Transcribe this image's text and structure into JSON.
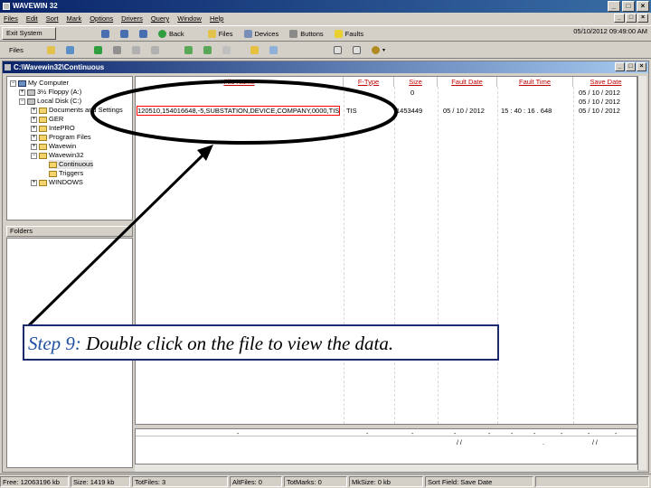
{
  "window": {
    "title": "WAVEWIN 32",
    "minimize": "_",
    "maximize": "□",
    "close": "×"
  },
  "menu": [
    "Files",
    "Edit",
    "Sort",
    "Mark",
    "Options",
    "Drivers",
    "Query",
    "Window",
    "Help"
  ],
  "toolbar1": {
    "exit_label": "Exit System",
    "back_label": "Back",
    "files_label": "Files",
    "devices_label": "Devices",
    "buttons_label": "Buttons",
    "faults_label": "Faults",
    "clock": "05/10/2012 09:49:00 AM"
  },
  "toolbar2": {
    "files_label": "Files"
  },
  "child": {
    "title": "C:\\Wavewin32\\Continuous"
  },
  "tree": {
    "my_computer": "My Computer",
    "floppy": "3½ Floppy (A:)",
    "local_disk": "Local Disk (C:)",
    "documents": "Documents and Settings",
    "ger": "GER",
    "intepro": "IntePRO",
    "program_files": "Program Files",
    "wavewin": "Wavewin",
    "wavewin32": "Wavewin32",
    "continuous": "Continuous",
    "triggers": "Triggers",
    "windows": "WINDOWS"
  },
  "folders_header": "Folders",
  "columns": {
    "file_name": "File Name",
    "ftype": "F-Type",
    "size": "Size",
    "fault_date": "Fault Date",
    "fault_time": "Fault Time",
    "save_date": "Save Date"
  },
  "rows": [
    {
      "name": "",
      "ftype": "",
      "size": "0",
      "fault_date": "",
      "fault_time": "",
      "save_date": "05 / 10 / 2012"
    },
    {
      "name": "",
      "ftype": "",
      "size": "",
      "fault_date": "",
      "fault_time": "",
      "save_date": "05 / 10 / 2012"
    },
    {
      "name": "120510,154016648,-5,SUBSTATION,DEVICE,COMPANY,0000,TIS",
      "ftype": "TIS",
      "size": "1453449",
      "fault_date": "05 / 10 / 2012",
      "fault_time": "15 : 40 : 16 . 648",
      "save_date": "05 / 10 / 2012"
    }
  ],
  "status": {
    "free": "Free: 12063196 kb",
    "size": "Size: 1419 kb",
    "tot_files": "TotFiles: 3",
    "alt_files": "AltFiles: 0",
    "tot_marks": "TotMarks: 0",
    "mk_size": "MkSize: 0 kb",
    "sort_field": "Sort Field: Save Date"
  },
  "caption": {
    "step": "Step 9:",
    "text": " Double click on the file to view the data."
  },
  "colors": {
    "caption_border": "#1c2a6e",
    "step_text": "#1f4fa0",
    "ellipse": "#000000",
    "highlight_box": "#ff0000"
  }
}
